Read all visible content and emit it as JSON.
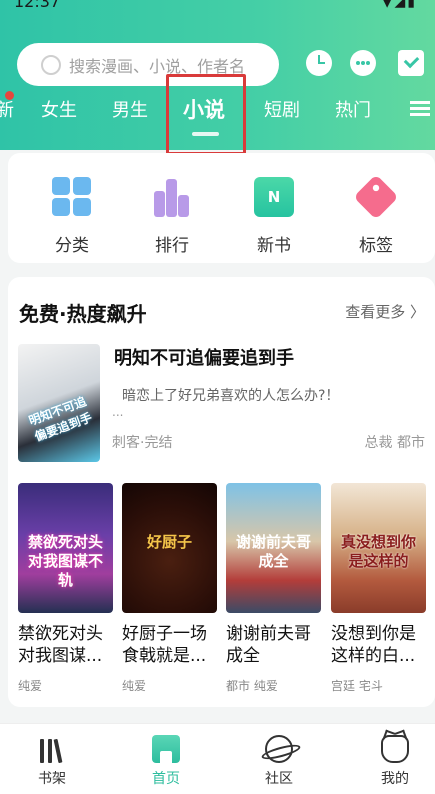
{
  "status": {
    "time": "12:37",
    "icons": "▼◢▮"
  },
  "search": {
    "placeholder": "搜索漫画、小说、作者名"
  },
  "header_icons": [
    "clock-icon",
    "message-icon",
    "task-icon"
  ],
  "tabs": [
    {
      "label": "新"
    },
    {
      "label": "女生"
    },
    {
      "label": "男生"
    },
    {
      "label": "小说",
      "active": true
    },
    {
      "label": "短剧"
    },
    {
      "label": "热门"
    }
  ],
  "categories": [
    {
      "label": "分类",
      "icon": "grid-icon"
    },
    {
      "label": "排行",
      "icon": "ranking-icon"
    },
    {
      "label": "新书",
      "icon": "new-book-icon",
      "glyph": "N"
    },
    {
      "label": "标签",
      "icon": "tag-icon"
    }
  ],
  "section": {
    "title": "免费·热度飙升",
    "more": "查看更多 〉",
    "featured": {
      "cover_text": "明知不可追偏要追到手",
      "title": "明知不可追偏要追到手",
      "desc": "暗恋上了好兄弟喜欢的人怎么办?！",
      "ellipsis": "...",
      "meta": "刺客·完结",
      "tags": "总裁 都市"
    },
    "books": [
      {
        "cover": "禁欲死对头对我图谋不轨",
        "title": "禁欲死对头对我图谋...",
        "tags": "纯爱"
      },
      {
        "cover": "好厨子",
        "title": "好厨子一场食戟就是...",
        "tags": "纯爱"
      },
      {
        "cover": "谢谢前夫哥成全",
        "title": "谢谢前夫哥成全",
        "tags": "都市 纯爱"
      },
      {
        "cover": "真没想到你是这样的",
        "title": "没想到你是这样的白...",
        "tags": "宫廷 宅斗"
      }
    ]
  },
  "bottom_nav": [
    {
      "label": "书架",
      "icon": "bookshelf-icon"
    },
    {
      "label": "首页",
      "icon": "home-icon",
      "active": true
    },
    {
      "label": "社区",
      "icon": "planet-icon"
    },
    {
      "label": "我的",
      "icon": "cat-profile-icon"
    }
  ],
  "colors": {
    "accent": "#2dbd9e",
    "highlight_box": "#d93a3a",
    "notify_dot": "#e6463d"
  }
}
